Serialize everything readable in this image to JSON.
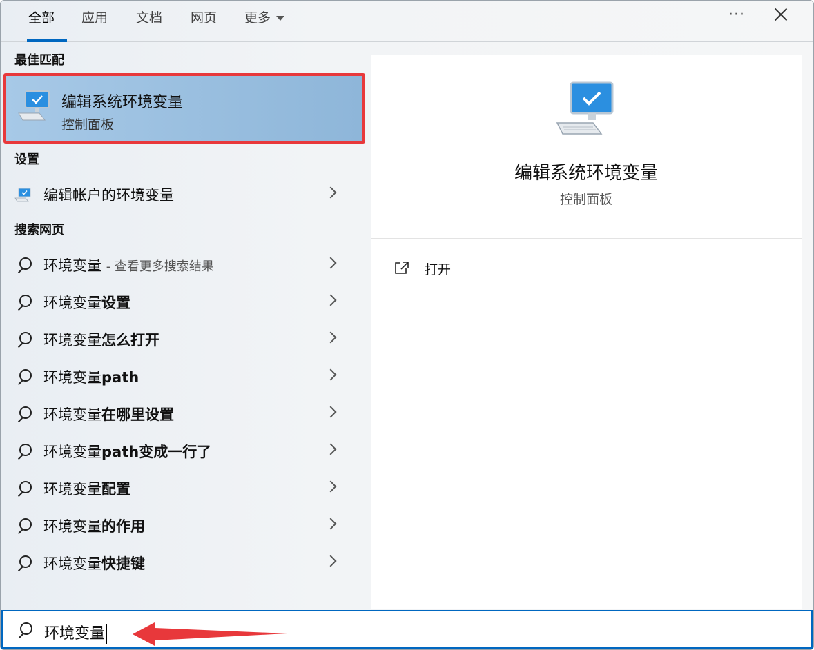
{
  "tabs": [
    {
      "label": "全部",
      "active": true
    },
    {
      "label": "应用"
    },
    {
      "label": "文档"
    },
    {
      "label": "网页"
    },
    {
      "label": "更多"
    }
  ],
  "toolbar": {
    "more_options": "···"
  },
  "sections": {
    "best_match": "最佳匹配",
    "settings": "设置",
    "web": "搜索网页"
  },
  "best_match": {
    "title": "编辑系统环境变量",
    "subtitle": "控制面板"
  },
  "settings_items": [
    {
      "label": "编辑帐户的环境变量"
    }
  ],
  "web_results": [
    {
      "query": "环境变量",
      "suffix": "",
      "hint": "- 查看更多搜索结果"
    },
    {
      "query": "环境变量",
      "suffix": "设置"
    },
    {
      "query": "环境变量",
      "suffix": "怎么打开"
    },
    {
      "query": "环境变量",
      "suffix": "path"
    },
    {
      "query": "环境变量",
      "suffix": "在哪里设置"
    },
    {
      "query": "环境变量",
      "suffix": "path变成一行了"
    },
    {
      "query": "环境变量",
      "suffix": "配置"
    },
    {
      "query": "环境变量",
      "suffix": "的作用"
    },
    {
      "query": "环境变量",
      "suffix": "快捷键"
    }
  ],
  "preview": {
    "title": "编辑系统环境变量",
    "subtitle": "控制面板",
    "actions": [
      {
        "label": "打开"
      }
    ]
  },
  "search": {
    "value": "环境变量"
  },
  "colors": {
    "accent": "#0067c0",
    "highlight_border": "#e8383b",
    "annotation_arrow": "#e8383b"
  }
}
